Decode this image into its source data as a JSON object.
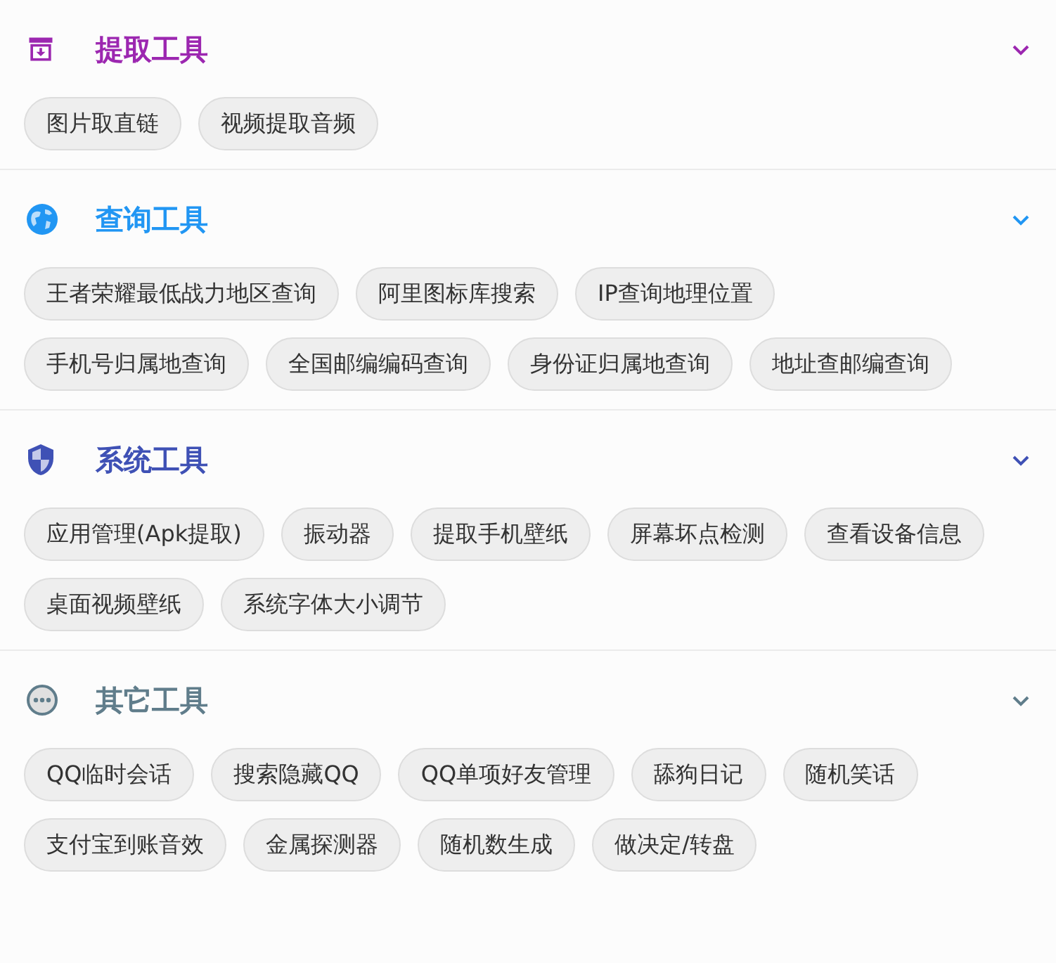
{
  "sections": [
    {
      "title": "提取工具",
      "kind": "archive",
      "color": "#9c27b0",
      "expanded": true,
      "tools": [
        "图片取直链",
        "视频提取音频"
      ]
    },
    {
      "title": "查询工具",
      "kind": "globe",
      "color": "#2196f3",
      "expanded": true,
      "tools": [
        "王者荣耀最低战力地区查询",
        "阿里图标库搜索",
        "IP查询地理位置",
        "手机号归属地查询",
        "全国邮编编码查询",
        "身份证归属地查询",
        "地址查邮编查询"
      ]
    },
    {
      "title": "系统工具",
      "kind": "shield",
      "color": "#3f51b5",
      "expanded": true,
      "tools": [
        "应用管理(Apk提取)",
        "振动器",
        "提取手机壁纸",
        "屏幕坏点检测",
        "查看设备信息",
        "桌面视频壁纸",
        "系统字体大小调节"
      ]
    },
    {
      "title": "其它工具",
      "kind": "more",
      "color": "#607d8b",
      "expanded": true,
      "tools": [
        "QQ临时会话",
        "搜索隐藏QQ",
        "QQ单项好友管理",
        "舔狗日记",
        "随机笑话",
        "支付宝到账音效",
        "金属探测器",
        "随机数生成",
        "做决定/转盘"
      ]
    }
  ]
}
